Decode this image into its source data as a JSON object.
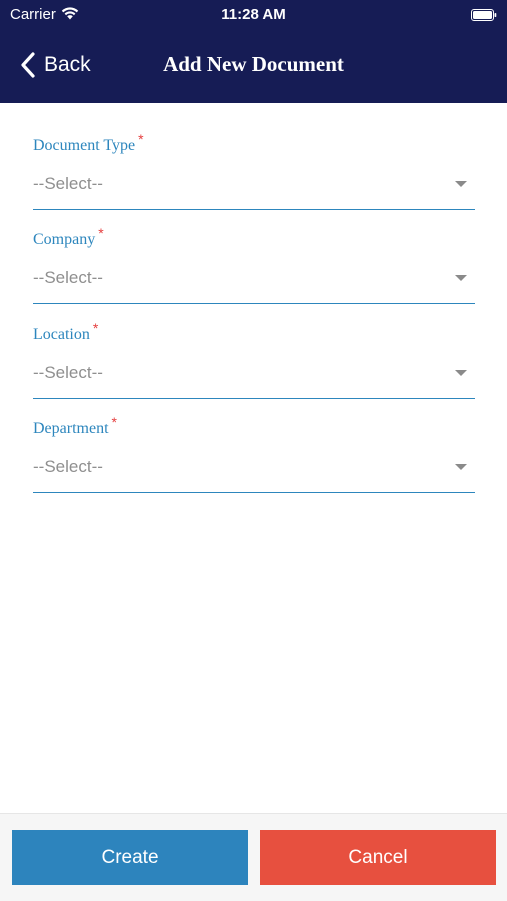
{
  "status_bar": {
    "carrier": "Carrier",
    "time": "11:28 AM"
  },
  "navbar": {
    "back_label": "Back",
    "title": "Add New Document"
  },
  "form": {
    "fields": [
      {
        "label": "Document Type",
        "required_marker": "*",
        "value": "--Select--"
      },
      {
        "label": "Company",
        "required_marker": "*",
        "value": "--Select--"
      },
      {
        "label": "Location",
        "required_marker": "*",
        "value": "--Select--"
      },
      {
        "label": "Department",
        "required_marker": "*",
        "value": "--Select--"
      }
    ]
  },
  "footer": {
    "create_label": "Create",
    "cancel_label": "Cancel"
  },
  "colors": {
    "header_bg": "#161c55",
    "accent": "#2d86bd",
    "required": "#e53e3e",
    "create_bg": "#2d84bd",
    "cancel_bg": "#e7503f"
  },
  "icons": [
    "wifi-icon",
    "battery-icon",
    "chevron-left-icon",
    "chevron-down-icon"
  ]
}
